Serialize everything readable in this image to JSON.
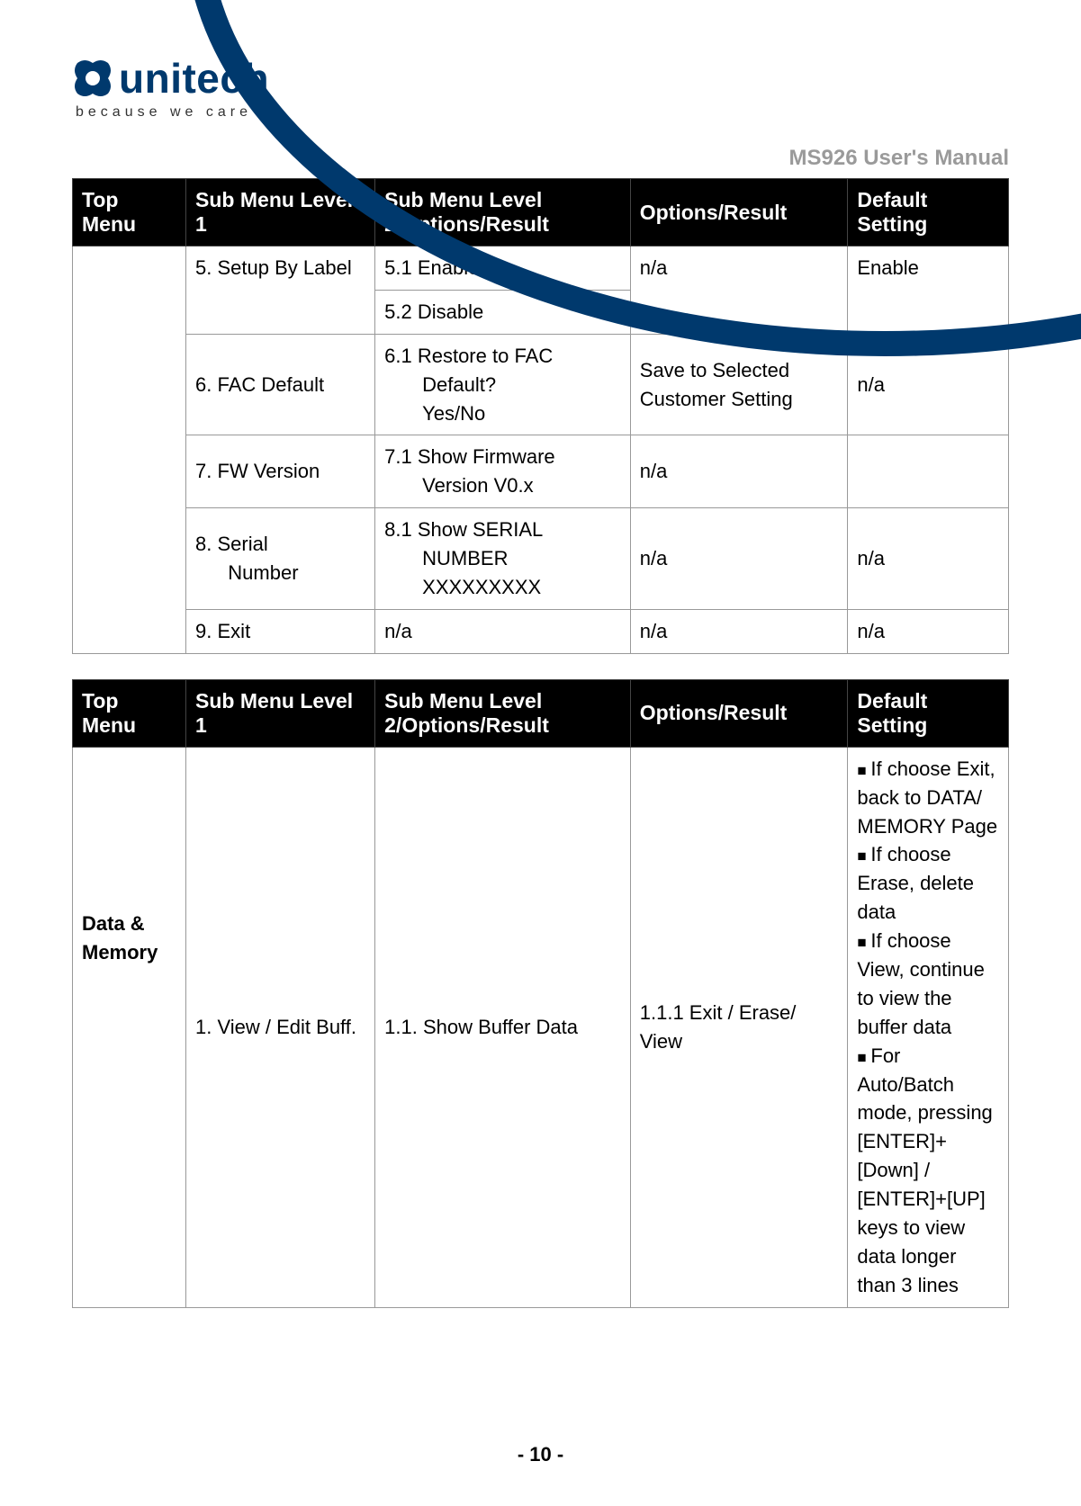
{
  "doc": {
    "title": "MS926 User's Manual",
    "page_footer": "- 10 -"
  },
  "logo": {
    "name": "unitech",
    "tagline": "because we care"
  },
  "table1": {
    "headers": [
      "Top Menu",
      "Sub Menu Level 1",
      "Sub Menu Level 2/Options/Result",
      "Options/Result",
      "Default Setting"
    ],
    "rows": {
      "r1": {
        "sub1": "5. Setup By Label",
        "sub2a": "5.1 Enable",
        "sub2b": "5.2 Disable",
        "opt": "n/a",
        "def": "Enable"
      },
      "r2": {
        "sub1": "6. FAC Default",
        "sub2": "6.1 Restore to FAC Default? Yes/No",
        "opt": "Save to Selected Customer Setting",
        "def": "n/a"
      },
      "r3": {
        "sub1": "7. FW Version",
        "sub2": "7.1 Show Firmware Version V0.x",
        "opt": "n/a",
        "def": ""
      },
      "r4": {
        "sub1": "8. Serial Number",
        "sub2": "8.1 Show SERIAL NUMBER XXXXXXXXX",
        "opt": "n/a",
        "def": "n/a"
      },
      "r5": {
        "sub1": "9. Exit",
        "sub2": "n/a",
        "opt": "n/a",
        "def": "n/a"
      }
    }
  },
  "table2": {
    "headers": [
      "Top Menu",
      "Sub Menu Level 1",
      "Sub Menu Level 2/Options/Result",
      "Options/Result",
      "Default Setting"
    ],
    "topmenu": "Data & Memory",
    "row": {
      "sub1": "1. View / Edit Buff.",
      "sub2": "1.1. Show Buffer Data",
      "opt": "1.1.1 Exit / Erase/ View",
      "def_items": [
        "If choose Exit, back to DATA/ MEMORY Page",
        "If choose Erase, delete data",
        "If choose View, continue to view the buffer data",
        "For Auto/Batch mode, pressing [ENTER]+[Down] / [ENTER]+[UP] keys to view data longer than 3 lines"
      ]
    }
  }
}
